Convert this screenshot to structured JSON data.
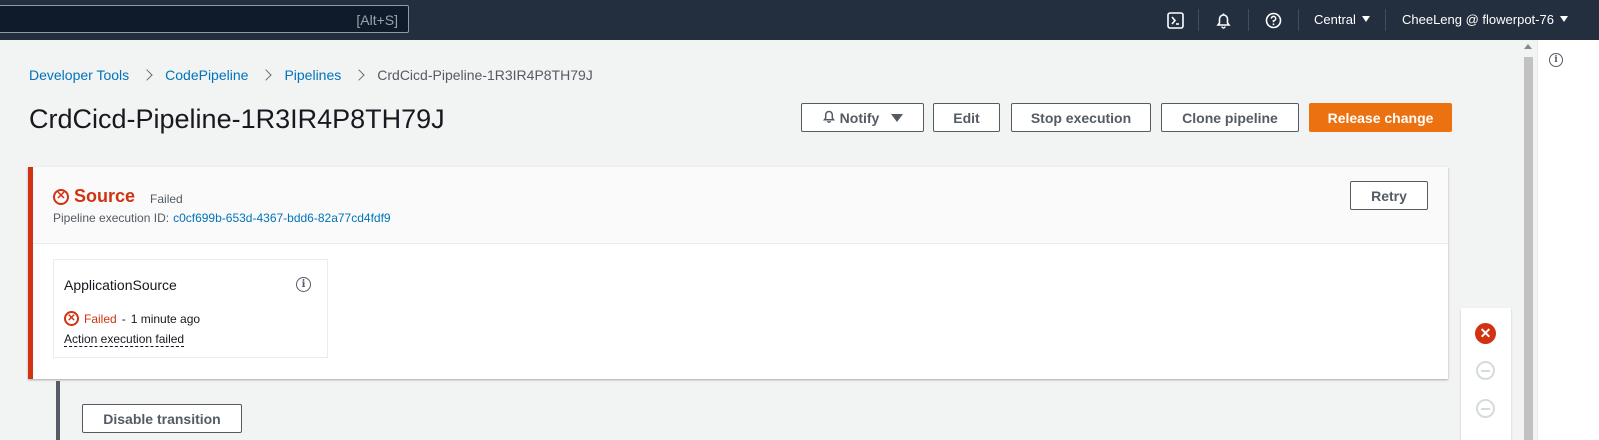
{
  "topnav": {
    "search_hint": "[Alt+S]",
    "icons": [
      "cloudshell-icon",
      "bell-icon",
      "help-icon"
    ],
    "region": "Central",
    "account": "CheeLeng @ flowerpot-76"
  },
  "breadcrumb": {
    "items": [
      "Developer Tools",
      "CodePipeline",
      "Pipelines"
    ],
    "current": "CrdCicd-Pipeline-1R3IR4P8TH79J"
  },
  "page": {
    "title": "CrdCicd-Pipeline-1R3IR4P8TH79J"
  },
  "actions": {
    "notify": "Notify",
    "edit": "Edit",
    "stop": "Stop execution",
    "clone": "Clone pipeline",
    "release": "Release change"
  },
  "stage": {
    "name": "Source",
    "status": "Failed",
    "exec_label": "Pipeline execution ID:",
    "exec_id": "c0cf699b-653d-4367-bdd6-82a77cd4fdf9",
    "retry": "Retry",
    "action": {
      "name": "ApplicationSource",
      "status": "Failed",
      "separator": "-",
      "time": "1 minute ago",
      "message": "Action execution failed"
    }
  },
  "transition": {
    "disable": "Disable transition"
  },
  "colors": {
    "nav_bg": "#232f3e",
    "link": "#0073bb",
    "error": "#d13212",
    "primary": "#ec7211"
  }
}
